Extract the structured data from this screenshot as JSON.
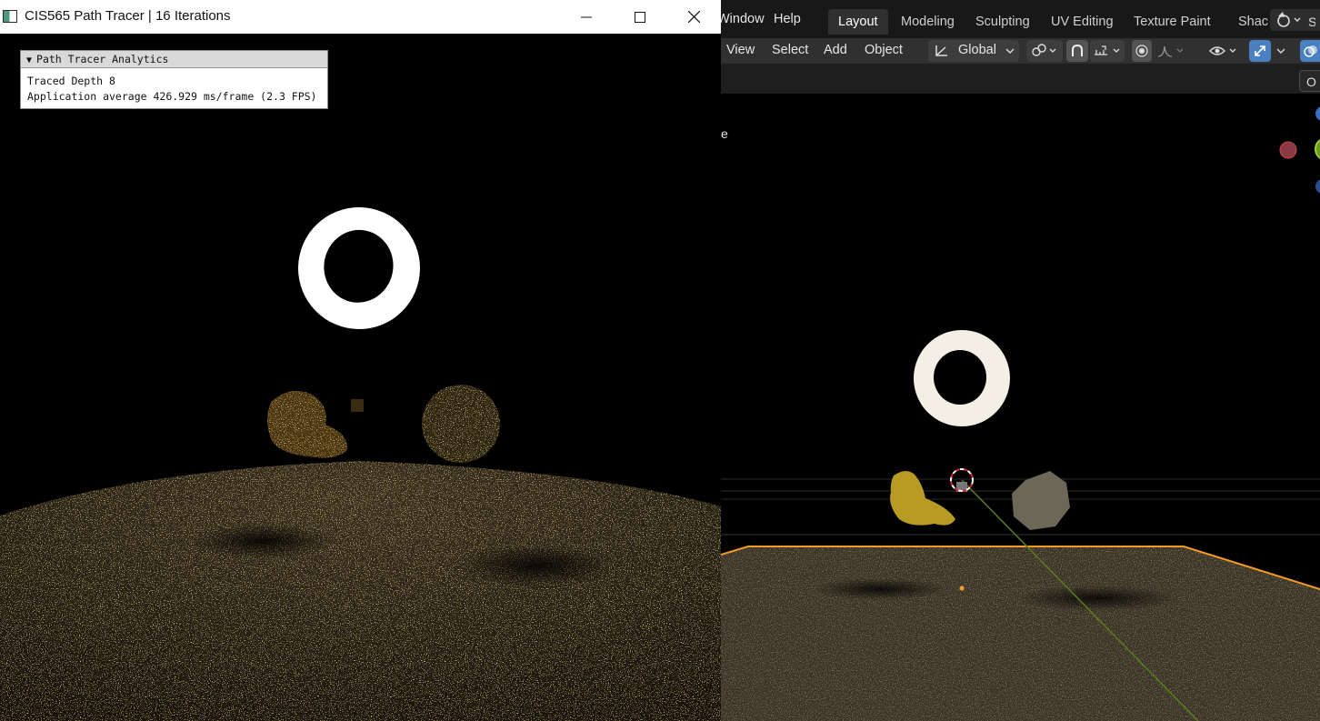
{
  "path_tracer": {
    "window_title": "CIS565 Path Tracer | 16 Iterations",
    "panel": {
      "header": "Path Tracer Analytics",
      "traced_depth": "Traced Depth 8",
      "average": "Application average 426.929 ms/frame (2.3 FPS)"
    }
  },
  "blender": {
    "menus": [
      "Window",
      "Help"
    ],
    "workspace_tabs": [
      "Layout",
      "Modeling",
      "Sculpting",
      "UV Editing",
      "Texture Paint",
      "Shac"
    ],
    "active_tab": "Layout",
    "header_menus": [
      "View",
      "Select",
      "Add",
      "Object"
    ],
    "transform_orientation": "Global",
    "right_partial_button": "O",
    "viewport_partial_label": "e"
  },
  "colors": {
    "blender_bg": "#181818",
    "blender_header": "#303030",
    "accent_blue": "#4a7fc0",
    "selection_orange": "#f59a23",
    "floor_tint": "#3b3426"
  }
}
